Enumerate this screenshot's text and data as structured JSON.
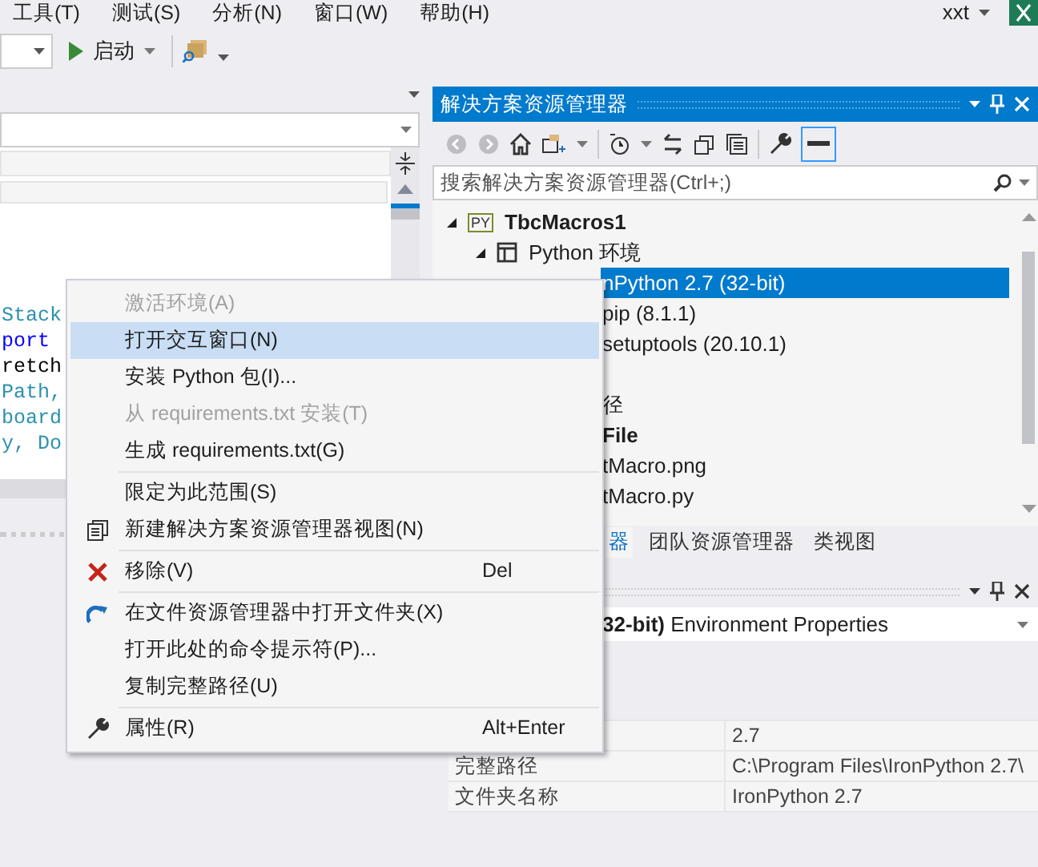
{
  "menubar": {
    "items": [
      "工具(T)",
      "测试(S)",
      "分析(N)",
      "窗口(W)",
      "帮助(H)"
    ],
    "user": "xxt"
  },
  "toolbar": {
    "start": "启动"
  },
  "editor": {
    "code_lines": [
      {
        "text": "Stack",
        "color": "#2b91af"
      },
      {
        "text": "port",
        "color": "#0000ff"
      },
      {
        "text": "retch",
        "color": "#000000"
      },
      {
        "text": "Path,",
        "color": "#2b91af"
      },
      {
        "text": "board",
        "color": "#2b91af"
      },
      {
        "text": "y, Do",
        "color": "#2b91af"
      }
    ]
  },
  "solution_explorer": {
    "title": "解决方案资源管理器",
    "search": {
      "placeholder": "搜索解决方案资源管理器(Ctrl+;)"
    },
    "tree": [
      {
        "label": "TbcMacros1",
        "icon_text": "PY",
        "bold": true,
        "expanded": true,
        "children": [
          {
            "label": "Python 环境",
            "bold": false,
            "expanded": true,
            "children": [
              {
                "label": "nPython 2.7 (32-bit)",
                "bold": false,
                "selected": true,
                "children": [
                  {
                    "label": "pip (8.1.1)",
                    "bold": false,
                    "selected": false
                  },
                  {
                    "label": "setuptools (20.10.1)",
                    "bold": false,
                    "selected": false
                  }
                ]
              }
            ]
          },
          {
            "label": "径",
            "bold": false
          },
          {
            "label": "File",
            "bold": true,
            "children": [
              {
                "label": "tMacro.png",
                "bold": false
              },
              {
                "label": "tMacro.py",
                "bold": false
              }
            ]
          }
        ]
      }
    ]
  },
  "bottom_tabs": [
    {
      "label": "器",
      "selected": true
    },
    {
      "label": "团队资源管理器",
      "selected": false
    },
    {
      "label": "类视图",
      "selected": false
    }
  ],
  "properties": {
    "header": "**32-bit)** Environment Properties",
    "rows": [
      {
        "value": "2.7"
      },
      {
        "name": "完整路径",
        "value": "C:\\Program Files\\IronPython 2.7\\"
      },
      {
        "name": "文件夹名称",
        "value": "IronPython 2.7"
      }
    ]
  },
  "context_menu": [
    {
      "kind": "item",
      "label": "激活环境(A)",
      "disabled": true,
      "selected": false
    },
    {
      "kind": "item",
      "label": "打开交互窗口(N)",
      "disabled": false,
      "selected": true
    },
    {
      "kind": "item",
      "label": "安装 Python 包(I)...",
      "disabled": false,
      "selected": false
    },
    {
      "kind": "item",
      "label": "从 requirements.txt 安装(T)",
      "disabled": true,
      "selected": false
    },
    {
      "kind": "item",
      "label": "生成 requirements.txt(G)",
      "disabled": false,
      "selected": false
    },
    {
      "kind": "separator"
    },
    {
      "kind": "item",
      "label": "限定为此范围(S)",
      "disabled": false,
      "selected": false
    },
    {
      "kind": "item",
      "label": "新建解决方案资源管理器视图(N)",
      "disabled": false,
      "selected": false
    },
    {
      "kind": "separator"
    },
    {
      "kind": "item",
      "label": "移除(V)",
      "shortcut": "Del",
      "disabled": false,
      "selected": false
    },
    {
      "kind": "separator"
    },
    {
      "kind": "item",
      "label": "在文件资源管理器中打开文件夹(X)",
      "disabled": false,
      "selected": false
    },
    {
      "kind": "item",
      "label": "打开此处的命令提示符(P)...",
      "disabled": false,
      "selected": false
    },
    {
      "kind": "item",
      "label": "复制完整路径(U)",
      "disabled": false,
      "selected": false
    },
    {
      "kind": "separator"
    },
    {
      "kind": "item",
      "label": "属性(R)",
      "shortcut": "Alt+Enter",
      "disabled": false,
      "selected": false
    }
  ]
}
